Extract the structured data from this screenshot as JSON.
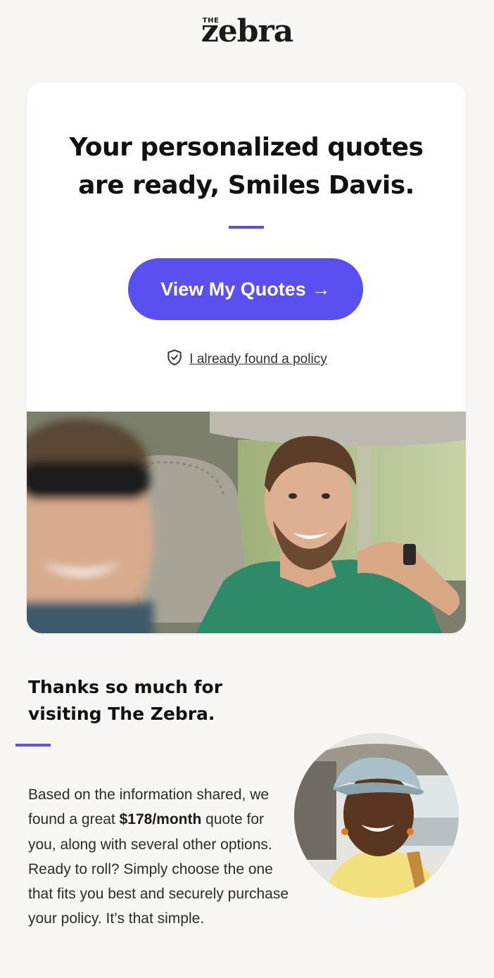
{
  "brand": {
    "logo_small": "THE",
    "logo_word": "zebra",
    "accent_color": "#5a4ff0"
  },
  "hero_card": {
    "headline_line1": "Your personalized quotes",
    "headline_line2": "are ready, Smiles Davis.",
    "cta_label": "View My Quotes",
    "cta_arrow": "→",
    "secondary_icon": "shield-check-icon",
    "secondary_link": "I already found a policy",
    "photo_alt": "Smiling man in car passenger seat with woman in sunglasses"
  },
  "thanks_section": {
    "title": "Thanks so much for visiting The Zebra.",
    "body_before": "Based on the information shared, we found a great ",
    "price_highlight": "$178/month",
    "body_after": " quote for you, along with several other options. Ready to roll? Simply choose the one that fits you best and securely purchase your policy. It’s that simple.",
    "portrait_alt": "Smiling woman in cap and yellow top in car"
  }
}
